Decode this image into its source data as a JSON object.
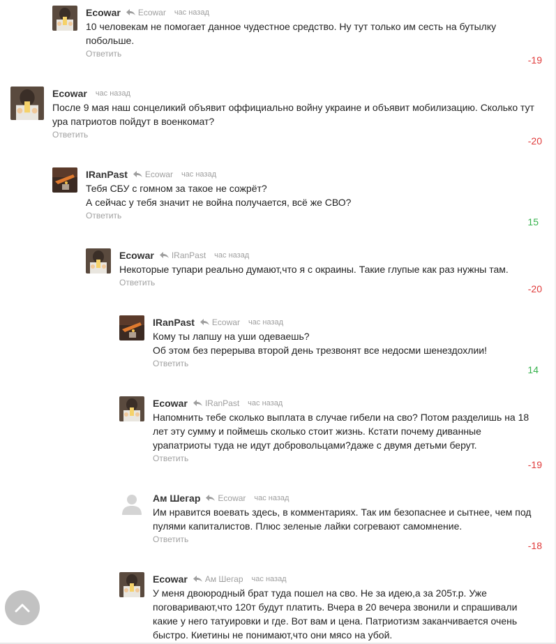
{
  "comments": [
    {
      "author": "Ecowar",
      "reply_to": "Ecowar",
      "time": "час назад",
      "text": "10 человекам не помогает данное чудестное средство. Ну тут только им сесть на бутылку побольше.",
      "reply_label": "Ответить",
      "score": "-19",
      "avatar": "ecowar"
    },
    {
      "author": "Ecowar",
      "reply_to": "",
      "time": "час назад",
      "text": "После 9 мая наш сонцеликий объявит оффициально войну украине и объявит мобилизацию. Сколько тут ура патриотов пойдут в военкомат?",
      "reply_label": "Ответить",
      "score": "-20",
      "avatar": "ecowar"
    },
    {
      "author": "IRanPast",
      "reply_to": "Ecowar",
      "time": "час назад",
      "text": "Тебя СБУ с гомном за такое не сожрёт?\nА сейчас у тебя значит не война получается, всё же СВО?",
      "reply_label": "Ответить",
      "score": "15",
      "avatar": "iranpast"
    },
    {
      "author": "Ecowar",
      "reply_to": "IRanPast",
      "time": "час назад",
      "text": "Некоторые тупари реально думают,что я с окраины. Такие глупые как раз нужны там.",
      "reply_label": "Ответить",
      "score": "-20",
      "avatar": "ecowar"
    },
    {
      "author": "IRanPast",
      "reply_to": "Ecowar",
      "time": "час назад",
      "text": "Кому ты лапшу на уши одеваешь?\nОб этом без перерыва второй день трезвонят все недосми шенездохлии!",
      "reply_label": "Ответить",
      "score": "14",
      "avatar": "iranpast"
    },
    {
      "author": "Ecowar",
      "reply_to": "IRanPast",
      "time": "час назад",
      "text": "Напомнить тебе сколько выплата в случае гибели на сво? Потом разделишь на 18 лет эту сумму и поймешь сколько стоит жизнь. Кстати почему диванные урапатриоты туда не идут добровольцами?даже с двумя детьми берут.",
      "reply_label": "Ответить",
      "score": "-19",
      "avatar": "ecowar"
    },
    {
      "author": "Ам Шегар",
      "reply_to": "Ecowar",
      "time": "час назад",
      "text": "Им нравится воевать здесь, в комментариях. Так им безопаснее и сытнее, чем под пулями капиталистов. Плюс зеленые лайки согревают самомнение.",
      "reply_label": "Ответить",
      "score": "-18",
      "avatar": "default"
    },
    {
      "author": "Ecowar",
      "reply_to": "Ам Шегар",
      "time": "час назад",
      "text": "У  меня двоюродный брат туда пошел на сво. Не за идею,а за 205т.р. Уже поговаривают,что 120т будут платить. Вчера в 20 вечера звонили и спрашивали какие у него татуировки и где. Вот вам и цена. Патриотизм заканчивается очень быстро. Киетины не понимают,что они мясо на убой.",
      "reply_label": "",
      "score": "",
      "avatar": "ecowar"
    }
  ],
  "colors": {
    "negative": "#e03a3a",
    "positive": "#37b24d",
    "muted": "#9e9e9e"
  },
  "icons": {
    "reply_arrow": "reply-arrow-icon",
    "scroll_top": "chevron-up-icon"
  }
}
